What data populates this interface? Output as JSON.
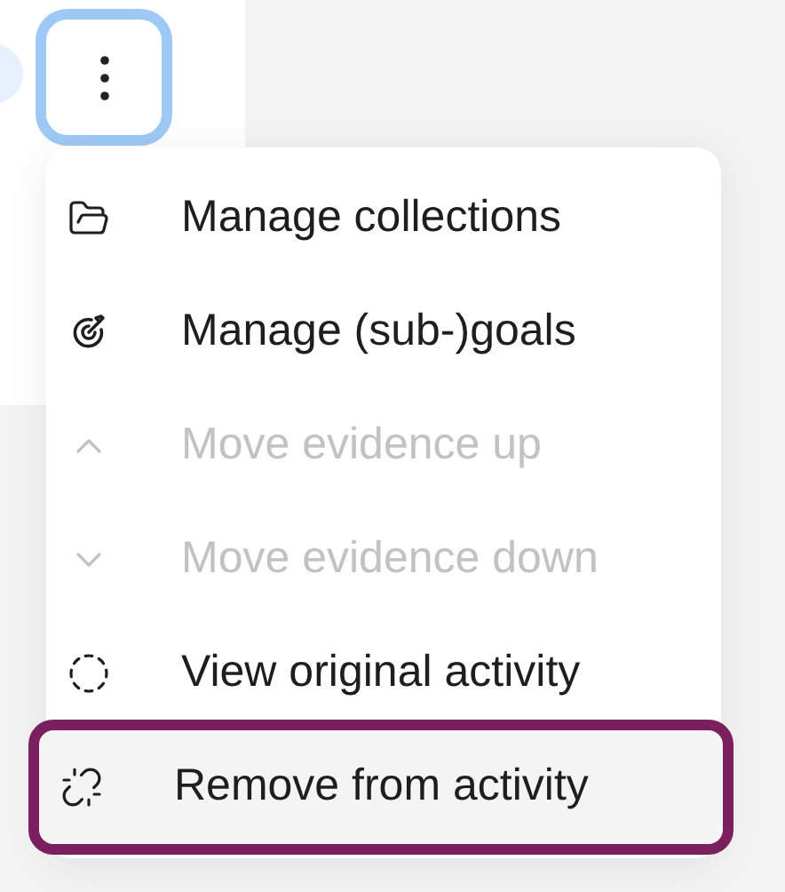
{
  "menu_button": {
    "expanded": true
  },
  "menu": {
    "items": [
      {
        "label": "Manage collections",
        "disabled": false,
        "selected": false
      },
      {
        "label": "Manage (sub-)goals",
        "disabled": false,
        "selected": false
      },
      {
        "label": "Move evidence up",
        "disabled": true,
        "selected": false
      },
      {
        "label": "Move evidence down",
        "disabled": true,
        "selected": false
      },
      {
        "label": "View original activity",
        "disabled": false,
        "selected": false
      },
      {
        "label": "Remove from activity",
        "disabled": false,
        "selected": true
      }
    ]
  }
}
